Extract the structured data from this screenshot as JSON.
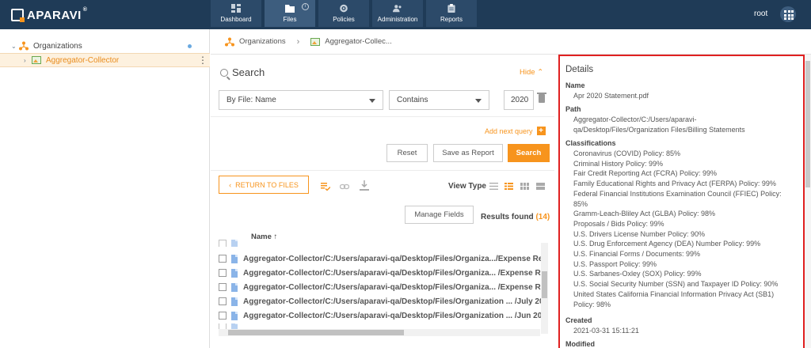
{
  "app": {
    "logo": "APARAVI",
    "logo_mark": "®"
  },
  "nav": [
    {
      "label": "Dashboard",
      "icon": "dashboard-icon"
    },
    {
      "label": "Files",
      "icon": "folder-icon",
      "active": true
    },
    {
      "label": "Policies",
      "icon": "gear-icon"
    },
    {
      "label": "Administration",
      "icon": "users-icon"
    },
    {
      "label": "Reports",
      "icon": "clipboard-icon"
    }
  ],
  "nav_info": "i",
  "user": "root",
  "tree": {
    "root_label": "Organizations",
    "selected_label": "Aggregator-Collector",
    "kebab": "⋮"
  },
  "breadcrumb": {
    "items": [
      "Organizations",
      "Aggregator-Collec..."
    ],
    "separator": "›"
  },
  "search": {
    "title": "Search",
    "hide_label": "Hide",
    "field_select": "By File: Name",
    "operator_select": "Contains",
    "value": "2020",
    "add_next_query": "Add next query",
    "plus": "+",
    "reset": "Reset",
    "save_as_report": "Save as Report",
    "search_button": "Search"
  },
  "toolbar": {
    "return_to_files": "RETURN TO FILES",
    "view_type": "View Type",
    "manage_fields": "Manage Fields",
    "results_label": "Results found",
    "results_count": "(14)"
  },
  "table": {
    "column_name": "Name",
    "sort_arrow": "↑",
    "rows": [
      "Aggregator-Collector/C:/Users/aparavi-qa/Desktop/Files/Organiza.../Expense Re",
      "Aggregator-Collector/C:/Users/aparavi-qa/Desktop/Files/Organiza... /Expense Re",
      "Aggregator-Collector/C:/Users/aparavi-qa/Desktop/Files/Organiza... /Expense Re",
      "Aggregator-Collector/C:/Users/aparavi-qa/Desktop/Files/Organization ... /July 20",
      "Aggregator-Collector/C:/Users/aparavi-qa/Desktop/Files/Organization ... /Jun 20"
    ]
  },
  "details": {
    "title": "Details",
    "name_label": "Name",
    "name_value": "Apr 2020 Statement.pdf",
    "path_label": "Path",
    "path_value": "Aggregator-Collector/C:/Users/aparavi-qa/Desktop/Files/Organization Files/Billing Statements",
    "classifications_label": "Classifications",
    "classifications": [
      "Coronavirus (COVID) Policy: 85%",
      "Criminal History Policy: 99%",
      "Fair Credit Reporting Act (FCRA) Policy: 99%",
      "Family Educational Rights and Privacy Act (FERPA) Policy: 99%",
      "Federal Financial Institutions Examination Council (FFIEC) Policy: 85%",
      "Gramm-Leach-Bliley Act (GLBA) Policy: 98%",
      "Proposals / Bids Policy: 99%",
      "U.S. Drivers License Number Policy: 90%",
      "U.S. Drug Enforcement Agency (DEA) Number Policy: 99%",
      "U.S. Financial Forms / Documents: 99%",
      "U.S. Passport Policy: 99%",
      "U.S. Sarbanes-Oxley (SOX) Policy: 99%",
      "U.S. Social Security Number (SSN) and Taxpayer ID Policy: 90%",
      "United States California Financial Information Privacy Act (SB1) Policy: 98%"
    ],
    "created_label": "Created",
    "created_value": "2021-03-31 15:11:21",
    "modified_label": "Modified"
  },
  "colors": {
    "topbar": "#1f3b57",
    "accent": "#f7941d",
    "highlight": "#e02020"
  }
}
